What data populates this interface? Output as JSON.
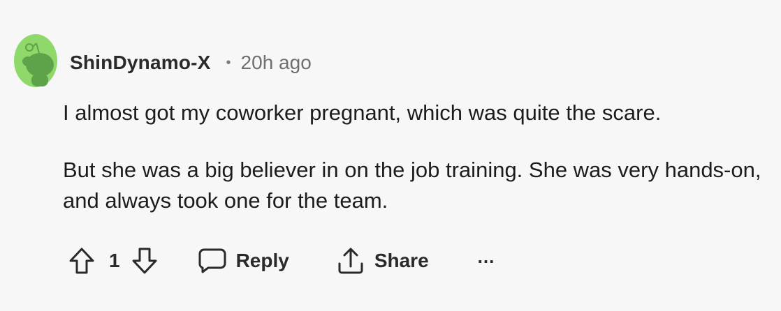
{
  "comment": {
    "author": "ShinDynamo-X",
    "separator": "•",
    "timestamp": "20h ago",
    "paragraphs": [
      "I almost got my coworker pregnant, which was quite the scare.",
      "But she was a big believer in on the job training. She was very hands-on, and always took one for the team."
    ]
  },
  "actions": {
    "vote_count": "1",
    "reply_label": "Reply",
    "share_label": "Share",
    "more_label": "..."
  },
  "icons": {
    "avatar": "snoo-avatar-icon",
    "upvote": "arrow-up-icon",
    "downvote": "arrow-down-icon",
    "reply": "speech-bubble-icon",
    "share": "share-icon"
  },
  "colors": {
    "avatar_bg": "#8fd96b",
    "avatar_figure": "#5ea34a",
    "text": "#1c1c1c",
    "meta": "#6f6f6f"
  }
}
